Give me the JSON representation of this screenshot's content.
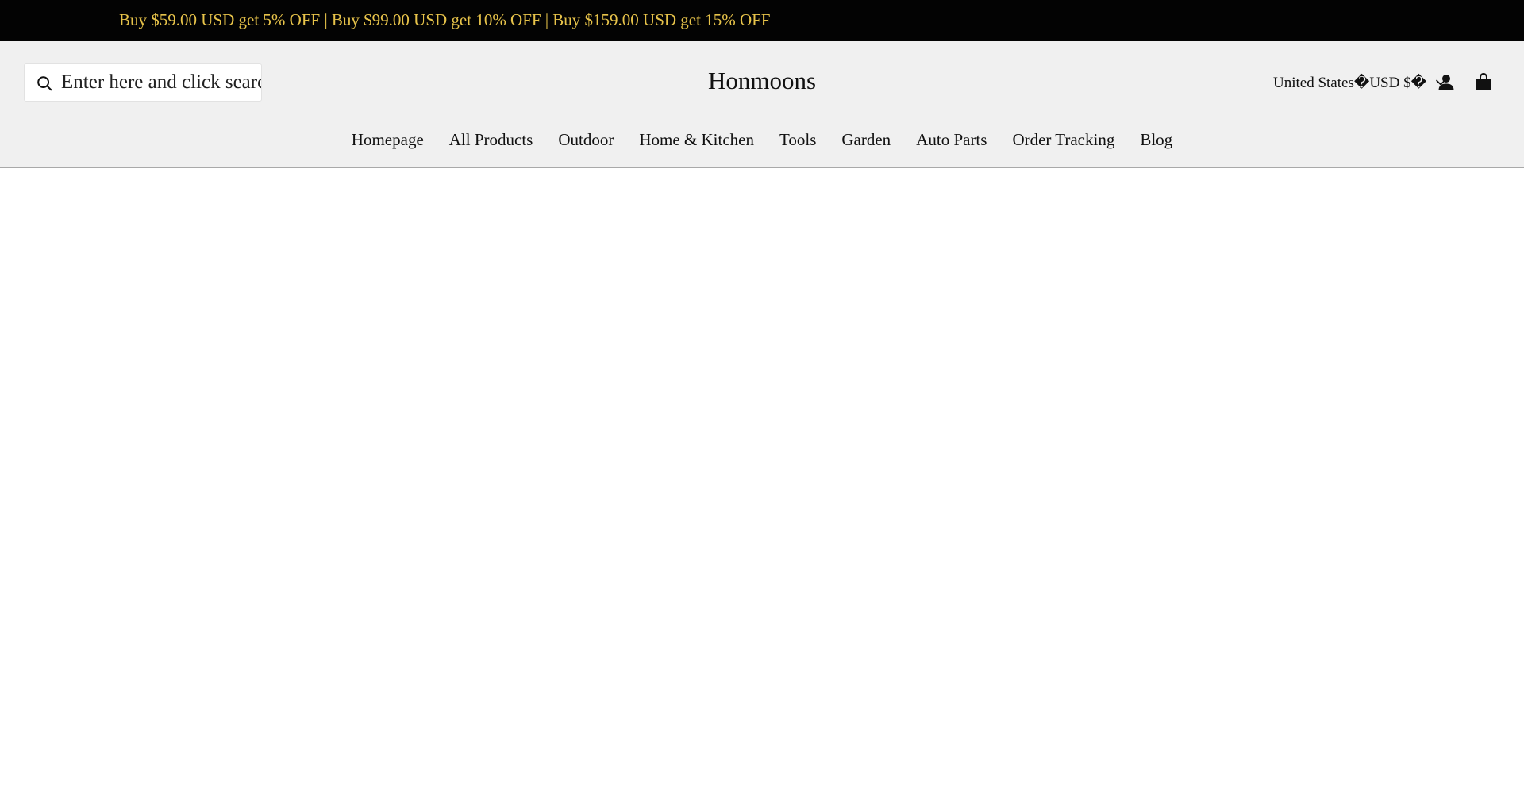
{
  "promo": {
    "text": "Buy $59.00 USD get 5% OFF | Buy $99.00 USD get 10% OFF | Buy $159.00 USD get 15% OFF",
    "text_color": "#e7c34a",
    "background": "#030303"
  },
  "header": {
    "background": "#f0f0f0",
    "search": {
      "placeholder": "Enter here and click search",
      "icon": "search-icon"
    },
    "logo": "Honmoons",
    "locale": {
      "label": "United States�USD $�",
      "icon": "chevron-down-icon"
    },
    "icons": {
      "account": "account-icon",
      "cart": "cart-icon"
    }
  },
  "nav": {
    "items": [
      {
        "label": "Homepage"
      },
      {
        "label": "All Products"
      },
      {
        "label": "Outdoor"
      },
      {
        "label": "Home & Kitchen"
      },
      {
        "label": "Tools"
      },
      {
        "label": "Garden"
      },
      {
        "label": "Auto Parts"
      },
      {
        "label": "Order Tracking"
      },
      {
        "label": "Blog"
      }
    ]
  }
}
